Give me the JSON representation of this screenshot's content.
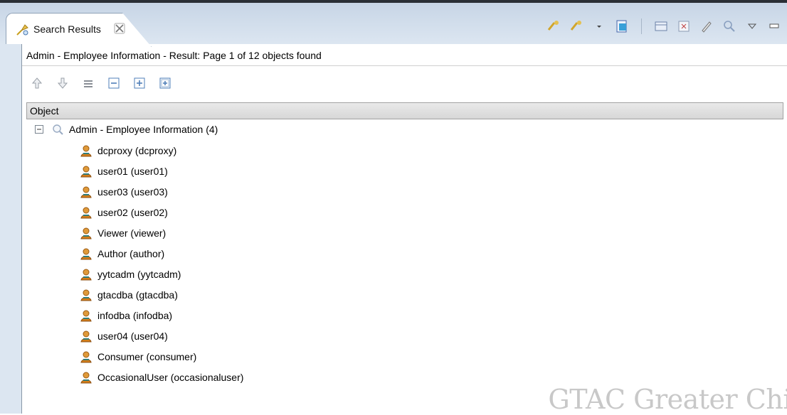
{
  "tab": {
    "label": "Search Results"
  },
  "result": {
    "title": "Admin - Employee Information - Result: Page 1 of 12 objects found"
  },
  "table": {
    "column_header": "Object"
  },
  "tree": {
    "root": {
      "label": "Admin - Employee Information (4)",
      "expanded": true
    },
    "items": [
      "dcproxy (dcproxy)",
      "user01 (user01)",
      "user03 (user03)",
      "user02 (user02)",
      "Viewer (viewer)",
      "Author (author)",
      "yytcadm (yytcadm)",
      "gtacdba (gtacdba)",
      "infodba (infodba)",
      "user04 (user04)",
      "Consumer (consumer)",
      "OccasionalUser (occasionaluser)"
    ]
  },
  "watermark": {
    "text": "GTAC Greater Chi"
  },
  "icons": {
    "tab": "search-results-icon",
    "close": "close-icon",
    "toolbar": [
      "saved-query-icon",
      "query-dropdown-icon",
      "export-icon",
      "table-view-icon",
      "clear-icon",
      "edit-icon",
      "find-icon",
      "view-menu-icon",
      "minimize-icon"
    ],
    "actions": [
      "move-up-icon",
      "move-down-icon",
      "collapse-all-icon",
      "collapse-icon",
      "expand-icon",
      "expand-all-icon"
    ],
    "root": "search-folder-icon",
    "item": "user-icon"
  },
  "colors": {
    "tab_bar": "#c7d5e6",
    "header": "#dcdcdc",
    "user_icon": "#d47e1a"
  }
}
